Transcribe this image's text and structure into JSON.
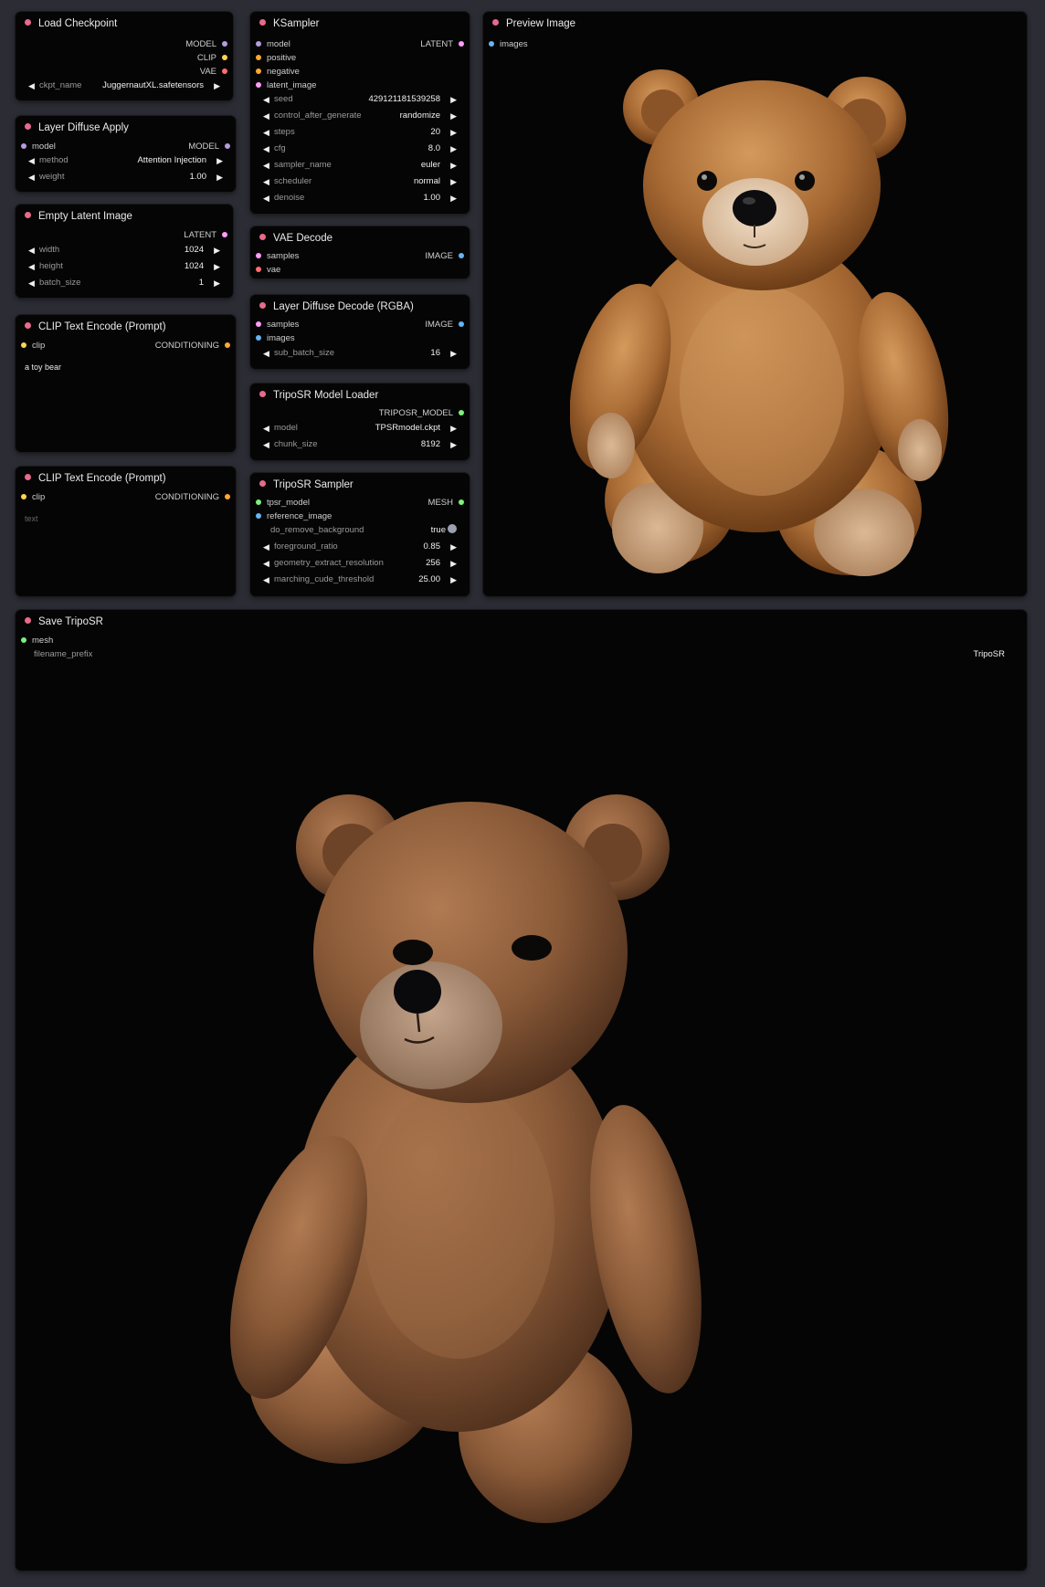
{
  "colors": {
    "canvas": "#2b2c34",
    "node_bg": "#050505",
    "title_dot": "#e86a8c",
    "MODEL": "#b39ddb",
    "CLIP": "#ffd54f",
    "VAE": "#ff6e6e",
    "LATENT": "#ff9cf9",
    "CONDITIONING": "#ffa931",
    "IMAGE": "#64b5f6",
    "MESH": "#7cf27c",
    "TRIPOSR_MODEL": "#7cf27c"
  },
  "load_checkpoint": {
    "title": "Load Checkpoint",
    "outputs": [
      "MODEL",
      "CLIP",
      "VAE"
    ],
    "ckpt_name_label": "ckpt_name",
    "ckpt_name_value": "JuggernautXL.safetensors"
  },
  "layer_diffuse_apply": {
    "title": "Layer Diffuse Apply",
    "input_model": "model",
    "output_model": "MODEL",
    "method_label": "method",
    "method_value": "Attention Injection",
    "weight_label": "weight",
    "weight_value": "1.00"
  },
  "empty_latent": {
    "title": "Empty Latent Image",
    "output": "LATENT",
    "width_label": "width",
    "width_value": "1024",
    "height_label": "height",
    "height_value": "1024",
    "batch_label": "batch_size",
    "batch_value": "1"
  },
  "clip_pos": {
    "title": "CLIP Text Encode (Prompt)",
    "input": "clip",
    "output": "CONDITIONING",
    "text": "a toy bear"
  },
  "clip_neg": {
    "title": "CLIP Text Encode (Prompt)",
    "input": "clip",
    "output": "CONDITIONING",
    "placeholder": "text"
  },
  "ksampler": {
    "title": "KSampler",
    "inputs": [
      "model",
      "positive",
      "negative",
      "latent_image"
    ],
    "output": "LATENT",
    "widgets": [
      {
        "label": "seed",
        "value": "429121181539258"
      },
      {
        "label": "control_after_generate",
        "value": "randomize"
      },
      {
        "label": "steps",
        "value": "20"
      },
      {
        "label": "cfg",
        "value": "8.0"
      },
      {
        "label": "sampler_name",
        "value": "euler"
      },
      {
        "label": "scheduler",
        "value": "normal"
      },
      {
        "label": "denoise",
        "value": "1.00"
      }
    ]
  },
  "vae_decode": {
    "title": "VAE Decode",
    "inputs": [
      "samples",
      "vae"
    ],
    "output": "IMAGE"
  },
  "layer_diffuse_decode": {
    "title": "Layer Diffuse Decode (RGBA)",
    "inputs": [
      "samples",
      "images"
    ],
    "output": "IMAGE",
    "sub_batch_label": "sub_batch_size",
    "sub_batch_value": "16"
  },
  "triposr_loader": {
    "title": "TripoSR Model Loader",
    "output": "TRIPOSR_MODEL",
    "model_label": "model",
    "model_value": "TPSRmodel.ckpt",
    "chunk_label": "chunk_size",
    "chunk_value": "8192"
  },
  "triposr_sampler": {
    "title": "TripoSR Sampler",
    "inputs": [
      "tpsr_model",
      "reference_image"
    ],
    "output": "MESH",
    "remove_bg_label": "do_remove_background",
    "remove_bg_value": "true",
    "widgets": [
      {
        "label": "foreground_ratio",
        "value": "0.85"
      },
      {
        "label": "geometry_extract_resolution",
        "value": "256"
      },
      {
        "label": "marching_cude_threshold",
        "value": "25.00"
      }
    ]
  },
  "preview_image": {
    "title": "Preview Image",
    "input": "images",
    "image_subject": "teddy-bear-photo"
  },
  "save_triposr": {
    "title": "Save TripoSR",
    "input": "mesh",
    "prefix_label": "filename_prefix",
    "prefix_value": "TripoSR",
    "image_subject": "teddy-bear-3d-render"
  },
  "icons": {
    "left_arrow": "◀",
    "right_arrow": "▶"
  }
}
